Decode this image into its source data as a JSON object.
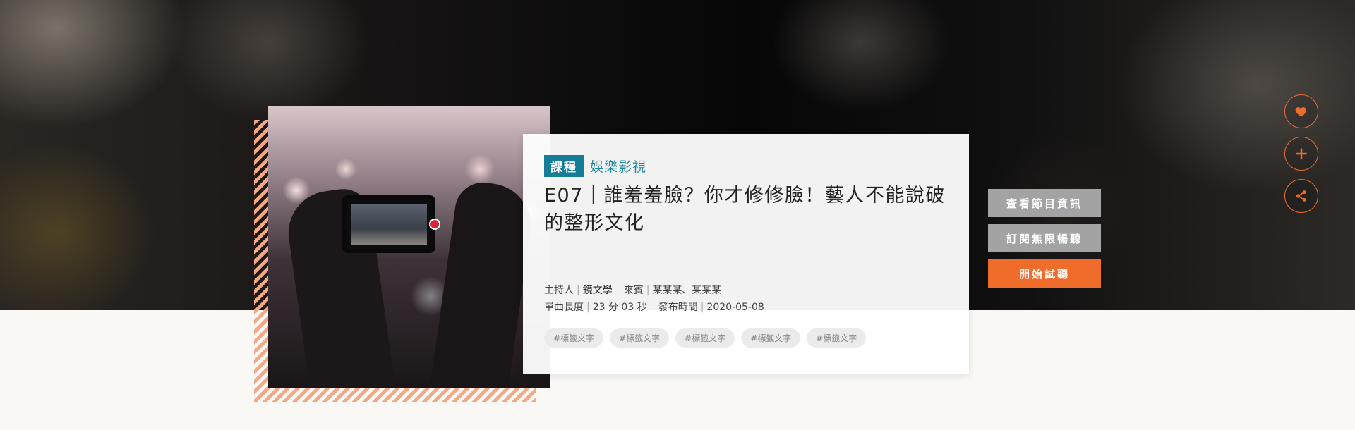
{
  "episode": {
    "badge": "課程",
    "category": "娛樂影視",
    "title": "E07｜誰羞羞臉？你才修修臉！藝人不能說破的整形文化",
    "meta": {
      "host_label": "主持人",
      "host": "鏡文學",
      "guest_label": "來賓",
      "guests": "某某某、某某某",
      "length_label": "單曲長度",
      "length": "23 分 03 秒",
      "published_label": "發布時間",
      "published": "2020-05-08"
    },
    "tags": [
      "#標籤文字",
      "#標籤文字",
      "#標籤文字",
      "#標籤文字",
      "#標籤文字"
    ]
  },
  "actions": {
    "program_info": "查看節目資訊",
    "subscribe": "訂閱無限暢聽",
    "trial": "開始試聽"
  },
  "side_tools": {
    "icons": [
      "heart-icon",
      "plus-icon",
      "share-icon"
    ]
  },
  "colors": {
    "accent": "#ef6c2b",
    "badge": "#167d96",
    "stripe": "#f6a885"
  }
}
